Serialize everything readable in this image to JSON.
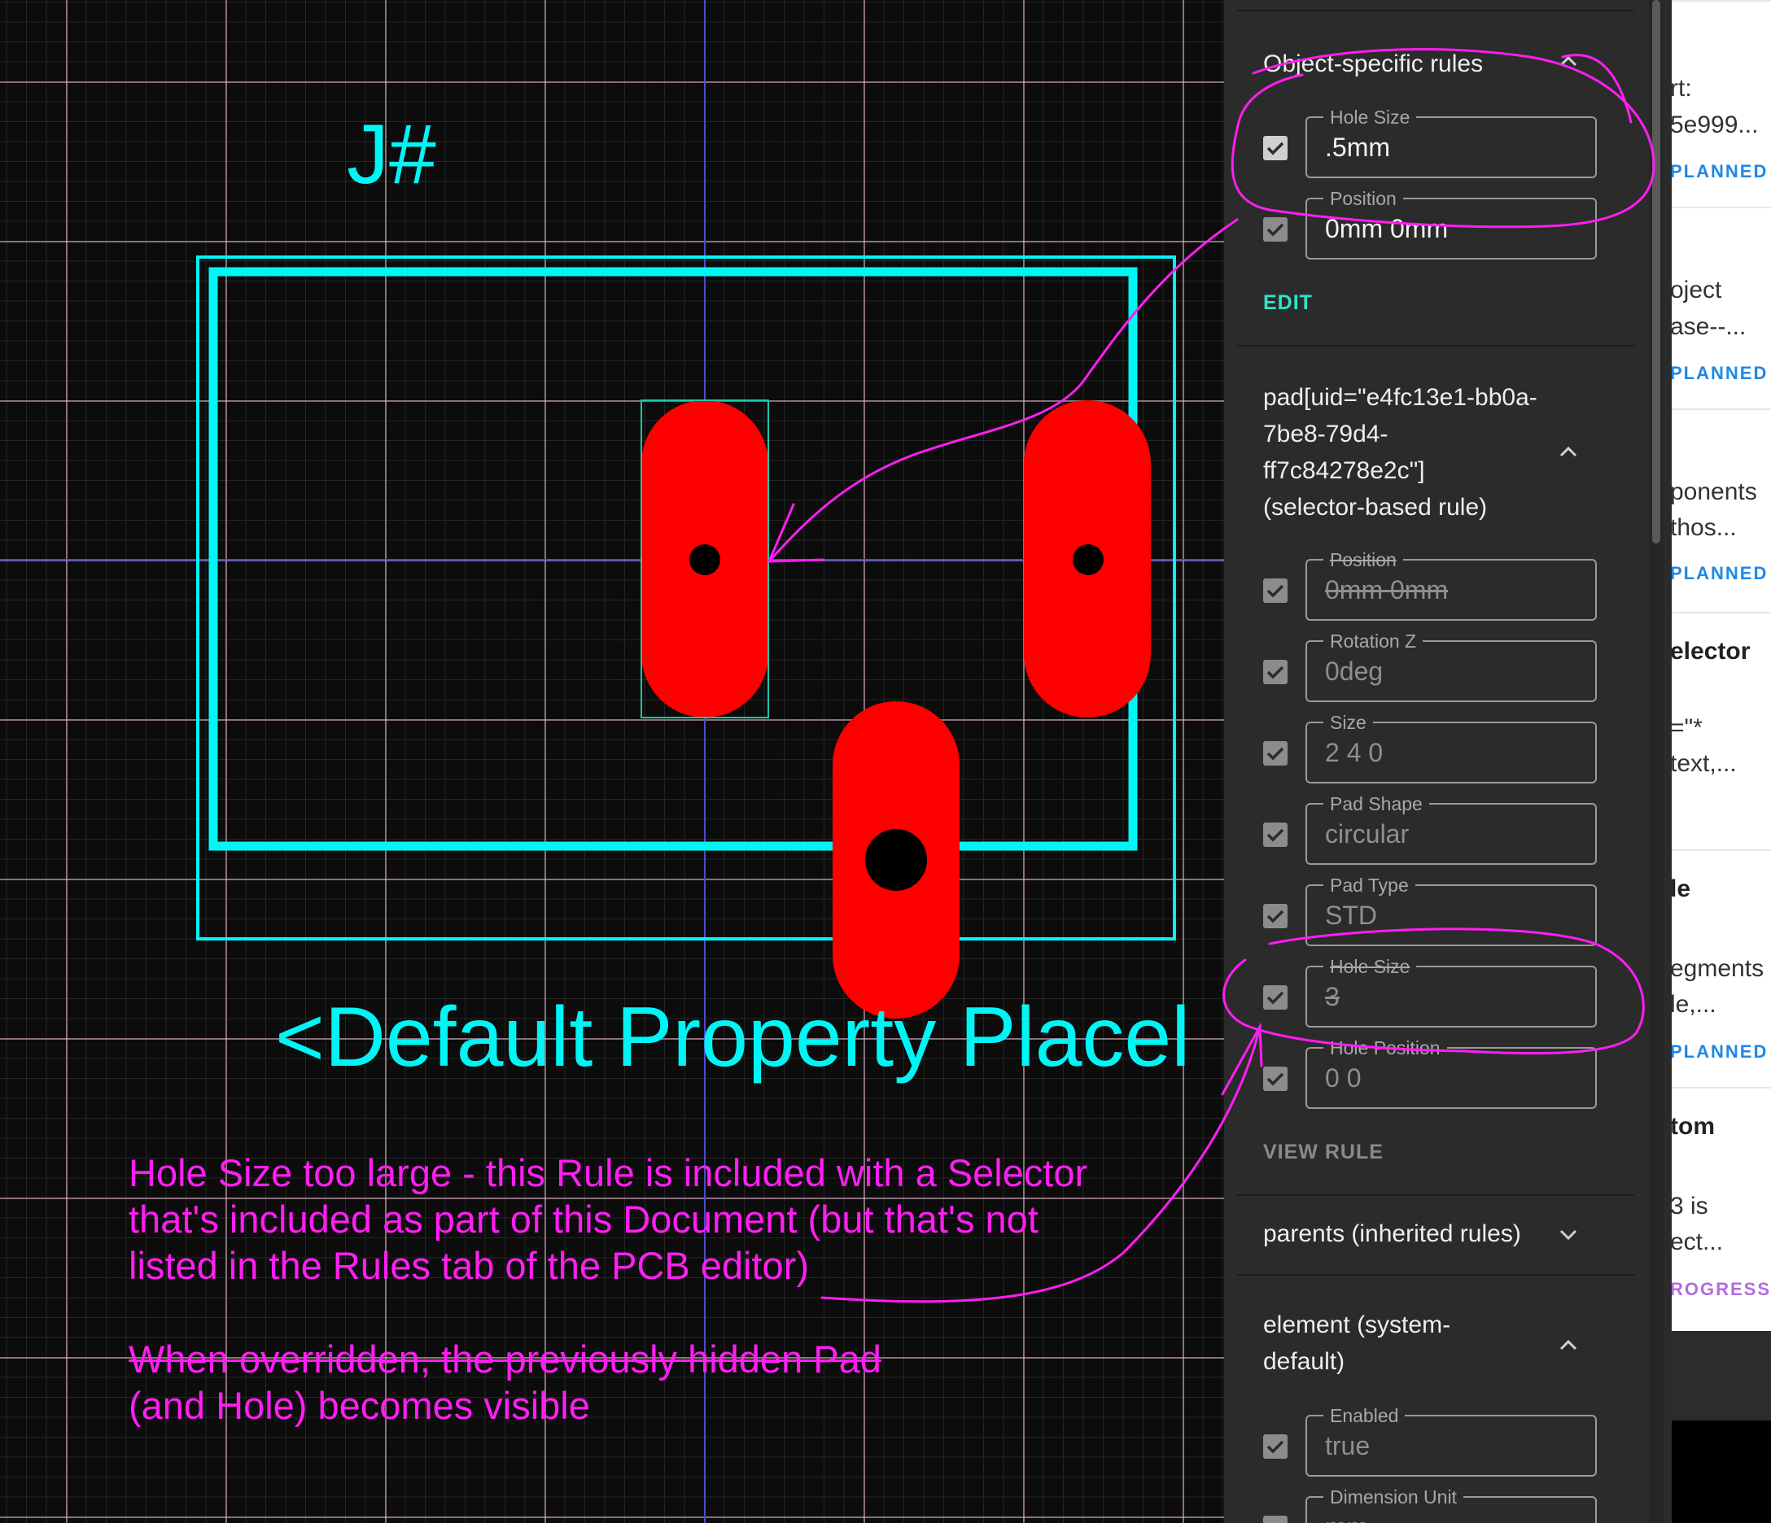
{
  "canvas": {
    "reference_designator": "J#",
    "default_property": "<Default Property Placel"
  },
  "annotations": {
    "note1": "Hole Size too large - this Rule is included with a Selector\nthat's included as part of this Document (but that's not\nlisted in the Rules tab of the PCB editor)",
    "note2_struck": "When overridden, the previously hidden Pad",
    "note3": "(and Hole) becomes visible",
    "color": "#ff1ef2"
  },
  "colors": {
    "silkscreen": "#00f5f5",
    "pad": "#ff0000",
    "selection": "#22c5a5",
    "accent": "#2ee6c8"
  },
  "rules_panel": {
    "object_rules": {
      "title": "Object-specific rules",
      "fields": [
        {
          "label": "Hole Size",
          "value": ".5mm"
        },
        {
          "label": "Position",
          "value": "0mm 0mm"
        }
      ],
      "edit_label": "EDIT"
    },
    "selector_rule": {
      "title": "pad[uid=\"e4fc13e1-bb0a-\n7be8-79d4-\nff7c84278e2c\"]\n(selector-based rule)",
      "fields": [
        {
          "label": "Position",
          "value": "0mm 0mm"
        },
        {
          "label": "Rotation Z",
          "value": "0deg"
        },
        {
          "label": "Size",
          "value": "2 4 0"
        },
        {
          "label": "Pad Shape",
          "value": "circular"
        },
        {
          "label": "Pad Type",
          "value": "STD"
        },
        {
          "label": "Hole Size",
          "value": "3"
        },
        {
          "label": "Hole Position",
          "value": "0 0"
        }
      ],
      "view_rule_label": "VIEW RULE"
    },
    "parents": {
      "title": "parents (inherited rules)"
    },
    "element": {
      "title": "element (system-\ndefault)",
      "fields": [
        {
          "label": "Enabled",
          "value": "true"
        },
        {
          "label": "Dimension Unit",
          "value": "mm"
        }
      ]
    }
  },
  "background_panel": {
    "cards": [
      {
        "lines": [
          "rt:",
          "5e999..."
        ],
        "status": "PLANNED"
      },
      {
        "lines": [
          "oject",
          "ase--..."
        ],
        "status": "PLANNED"
      },
      {
        "lines": [
          "ponents",
          " thos..."
        ],
        "status": "PLANNED"
      },
      {
        "heading": "elector",
        "lines": [
          "=\"*",
          "text,..."
        ]
      },
      {
        "heading": "le",
        "lines": [
          "egments",
          "le,..."
        ],
        "status": "PLANNED"
      },
      {
        "heading": "tom",
        "lines": [
          "3 is",
          "ect..."
        ],
        "status": "ROGRESS"
      }
    ]
  }
}
